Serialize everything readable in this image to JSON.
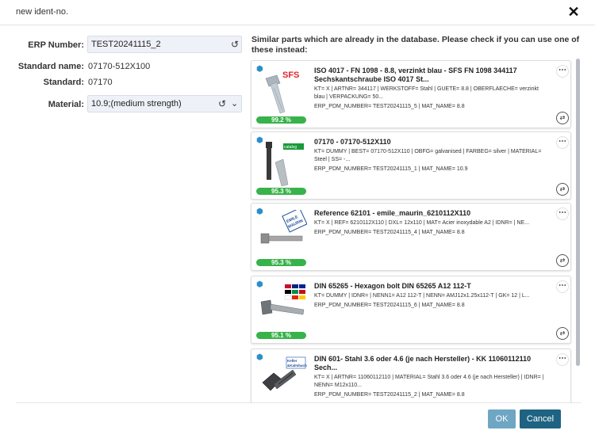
{
  "dialog": {
    "title": "new ident-no."
  },
  "form": {
    "erp_label": "ERP Number:",
    "erp_value": "TEST20241115_2",
    "standard_name_label": "Standard name:",
    "standard_name_value": "07170-512X100",
    "standard_label": "Standard:",
    "standard_value": "07170",
    "material_label": "Material:",
    "material_value": "10.9;(medium strength)"
  },
  "similar": {
    "hint": "Similar parts which are already in the database. Please check if you can use one of these instead:",
    "items": [
      {
        "title": "ISO 4017 - FN 1098 - 8.8, verzinkt blau - SFS FN 1098 344117 Sechskantschraube ISO 4017 St...",
        "attrs": "KT= X | ARTNR= 344117 | WERKSTOFF= Stahl | GUETE= 8.8 | OBERFLAECHE= verzinkt blau | VERPACKUNG= 50...",
        "erp": "ERP_PDM_NUMBER= TEST20241115_5 | MAT_NAME= 8.8",
        "match": "99.2 %",
        "match_value": 99.2,
        "brand": "SFS"
      },
      {
        "title": "07170 - 07170-512X110",
        "attrs": "KT= DUMMY | BEST= 07170-512X110 | OBFG= galvanised | FARBEG= silver | MATERIAL= Steel | SS= -...",
        "erp": "ERP_PDM_NUMBER= TEST20241115_1 | MAT_NAME= 10.9",
        "match": "95.3 %",
        "match_value": 95.3,
        "brand": "catalog"
      },
      {
        "title": "Reference 62101 - emile_maurin_6210112X110",
        "attrs": "KT= X | REF= 6210112X110 | DXL= 12x110 | MAT= Acier inoxydable A2 | IDNR= | NE...",
        "erp": "ERP_PDM_NUMBER= TEST20241115_4 | MAT_NAME= 8.8",
        "match": "95.3 %",
        "match_value": 95.3,
        "brand": "EMILE MAURIN"
      },
      {
        "title": "DIN 65265 - Hexagon bolt DIN 65265 A12 112-T",
        "attrs": "KT= DUMMY | IDNR= | NENN1= A12 112-T | NENN= AMJ12x1.25x112-T | GK= 12 | L...",
        "erp": "ERP_PDM_NUMBER= TEST20241115_6 | MAT_NAME= 8.8",
        "match": "95.1 %",
        "match_value": 95.1,
        "brand": "flags"
      },
      {
        "title": "DIN 601- Stahl 3.6 oder 4.6 (je nach Hersteller) - KK 11060112110 Sech...",
        "attrs": "KT= X | ARTNR= 11060112110 | MATERIAL= Stahl 3.6 oder 4.6 (je nach Hersteller) | IDNR= | NENN= M12x110...",
        "erp": "ERP_PDM_NUMBER= TEST20241115_2 | MAT_NAME= 8.8",
        "match": "",
        "match_value": null,
        "brand": "Keller & Kalmbach"
      }
    ]
  },
  "buttons": {
    "ok": "OK",
    "cancel": "Cancel"
  },
  "colors": {
    "accent": "#1f6382",
    "ok": "#6fa6c4",
    "match_bar": "#38b24a",
    "field_bg": "#eef1f7"
  }
}
